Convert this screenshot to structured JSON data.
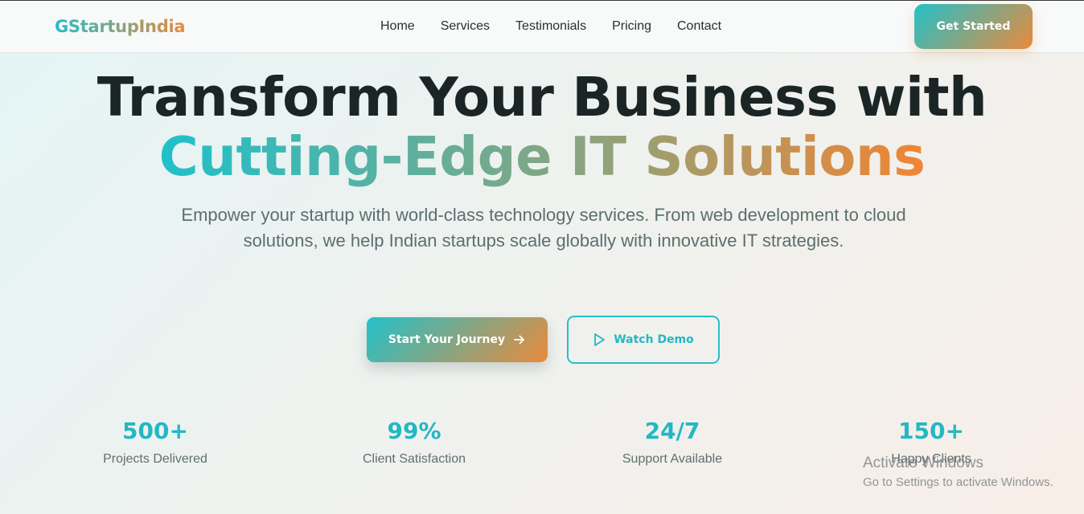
{
  "header": {
    "logo": "GStartupIndia",
    "nav": [
      "Home",
      "Services",
      "Testimonials",
      "Pricing",
      "Contact"
    ],
    "cta": "Get Started"
  },
  "hero": {
    "title_line1": "Transform Your Business with",
    "title_line2": "Cutting-Edge IT Solutions",
    "subtitle": "Empower your startup with world-class technology services. From web development to cloud solutions, we help Indian startups scale globally with innovative IT strategies.",
    "primary_button": "Start Your Journey",
    "primary_icon": "arrow-right-icon",
    "secondary_button": "Watch Demo",
    "secondary_icon": "play-icon"
  },
  "stats": [
    {
      "value": "500+",
      "label": "Projects Delivered"
    },
    {
      "value": "99%",
      "label": "Client Satisfaction"
    },
    {
      "value": "24/7",
      "label": "Support Available"
    },
    {
      "value": "150+",
      "label": "Happy Clients"
    }
  ],
  "watermark": {
    "title": "Activate Windows",
    "subtitle": "Go to Settings to activate Windows."
  },
  "colors": {
    "accent_teal": "#22c1c9",
    "accent_orange": "#e98a3c",
    "text_dark": "#1b2526"
  }
}
